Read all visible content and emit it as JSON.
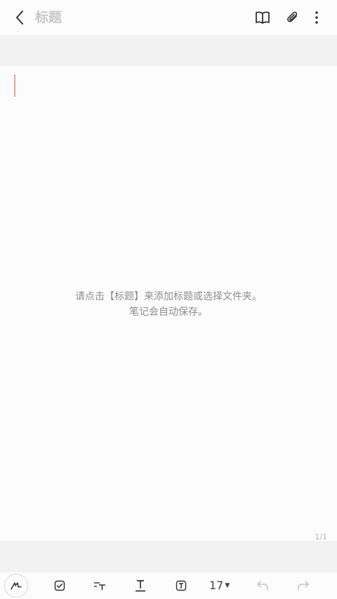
{
  "header": {
    "title": "标题",
    "icons": [
      "back-arrow-icon",
      "book-icon",
      "paperclip-icon",
      "more-vert-icon"
    ]
  },
  "editor": {
    "hint_line1": "请点击【标题】来添加标题或选择文件夹。",
    "hint_line2": "笔记会自动保存。",
    "page_indicator": "1/1"
  },
  "toolbar": {
    "font_size": "17",
    "icons": [
      "handwriting-pen-icon",
      "checkbox-icon",
      "paragraph-style-icon",
      "text-underline-icon",
      "text-box-icon",
      "undo-icon",
      "redo-icon"
    ]
  },
  "colors": {
    "caret": "#e6a58e",
    "title_placeholder": "#c8c8c8",
    "hint_text": "#8d8d8d",
    "strip_bg": "#f2f2f2"
  }
}
